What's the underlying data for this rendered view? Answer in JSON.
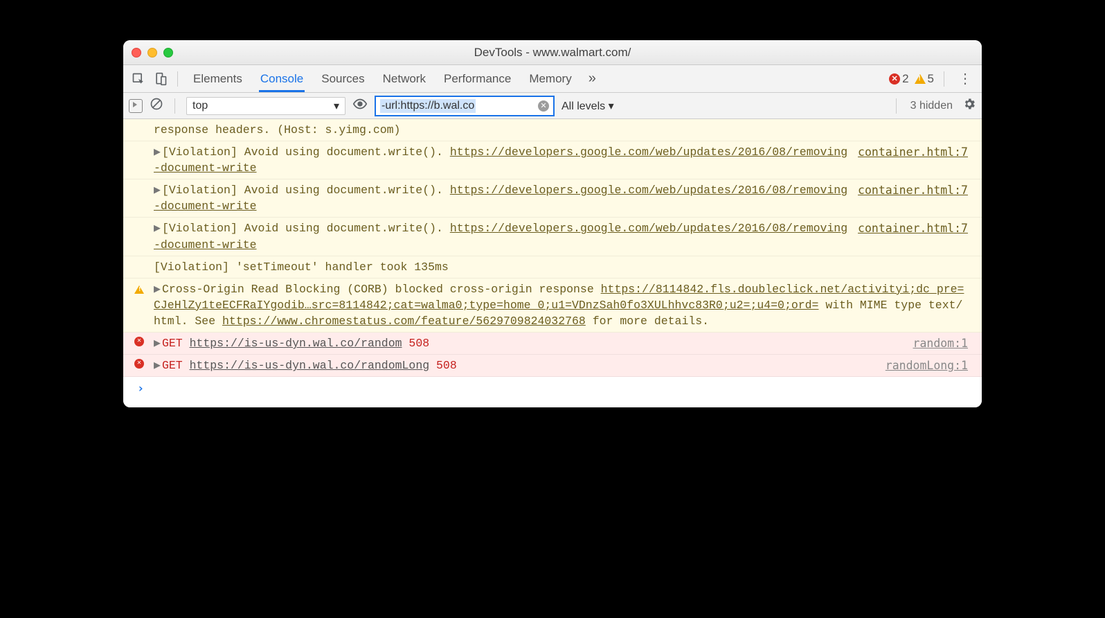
{
  "window": {
    "title": "DevTools - www.walmart.com/"
  },
  "toolbar": {
    "tabs": [
      "Elements",
      "Console",
      "Sources",
      "Network",
      "Performance",
      "Memory"
    ],
    "active_tab_index": 1,
    "more_glyph": "»",
    "error_count": "2",
    "warning_count": "5",
    "kebab_glyph": "⋮"
  },
  "filterbar": {
    "context": "top",
    "filter_text": "-url:https://b.wal.co",
    "levels": "All levels ▾",
    "hidden": "3 hidden"
  },
  "log": {
    "partial_row": "response headers. (Host: s.yimg.com)",
    "violation_prefix": "[Violation] Avoid using document.write(). ",
    "violation_link": "https://developers.google.com/web/updates/2016/08/removing-document-write",
    "violation_source": "container.html:7",
    "timeout_row": "[Violation] 'setTimeout' handler took 135ms",
    "corb": {
      "pre": "Cross-Origin Read Blocking (CORB) blocked cross-origin response ",
      "url1": "https://8114842.fls.doubleclick.net/activityi;dc_pre=CJeHlZy1teECFRaIYgodib…src=8114842;cat=walma0;type=home_0;u1=VDnzSah0fo3XULhhvc83R0;u2=;u4=0;ord=",
      "mid": " with MIME type text/html. See ",
      "url2": "https://www.chromestatus.com/feature/5629709824032768",
      "post": " for more details."
    },
    "errors": [
      {
        "method": "GET",
        "url": "https://is-us-dyn.wal.co/random",
        "status": "508",
        "source": "random:1"
      },
      {
        "method": "GET",
        "url": "https://is-us-dyn.wal.co/randomLong",
        "status": "508",
        "source": "randomLong:1"
      }
    ]
  },
  "prompt": {
    "glyph": "›"
  }
}
